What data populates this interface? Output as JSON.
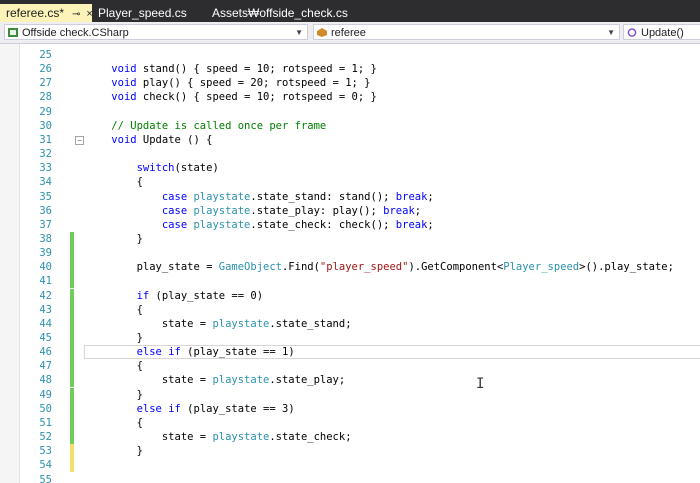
{
  "tabs": [
    {
      "label": "referee.cs*",
      "active": true,
      "pin": "⊸",
      "close": "×"
    },
    {
      "label": "Player_speed.cs",
      "active": false
    },
    {
      "label": "Assets₩offside_check.cs",
      "active": false
    }
  ],
  "nav": {
    "project": "Offside check.CSharp",
    "class": "referee",
    "member": "Update()"
  },
  "colors": {
    "keyword": "#0000ff",
    "type": "#2b91af",
    "comment": "#008000",
    "string": "#a31515",
    "changed_saved": "#6fcd5e",
    "changed_unsaved": "#efe16a"
  },
  "lines": [
    {
      "num": "25",
      "text": "",
      "marker": ""
    },
    {
      "num": "26",
      "text": "    void stand() { speed = 10; rotspeed = 1; }",
      "marker": ""
    },
    {
      "num": "27",
      "text": "    void play() { speed = 20; rotspeed = 1; }",
      "marker": ""
    },
    {
      "num": "28",
      "text": "    void check() { speed = 10; rotspeed = 0; }",
      "marker": ""
    },
    {
      "num": "29",
      "text": "",
      "marker": ""
    },
    {
      "num": "30",
      "text": "    // Update is called once per frame",
      "marker": ""
    },
    {
      "num": "31",
      "text": "    void Update () {",
      "marker": "",
      "fold": "−"
    },
    {
      "num": "32",
      "text": "",
      "marker": ""
    },
    {
      "num": "33",
      "text": "        switch(state)",
      "marker": ""
    },
    {
      "num": "34",
      "text": "        {",
      "marker": ""
    },
    {
      "num": "35",
      "text": "            case playstate.state_stand: stand(); break;",
      "marker": ""
    },
    {
      "num": "36",
      "text": "            case playstate.state_play: play(); break;",
      "marker": ""
    },
    {
      "num": "37",
      "text": "            case playstate.state_check: check(); break;",
      "marker": ""
    },
    {
      "num": "38",
      "text": "        }",
      "marker": "saved"
    },
    {
      "num": "39",
      "text": "",
      "marker": "saved"
    },
    {
      "num": "40",
      "text": "        play_state = GameObject.Find(\"player_speed\").GetComponent<Player_speed>().play_state;",
      "marker": "saved"
    },
    {
      "num": "41",
      "text": "",
      "marker": "saved"
    },
    {
      "num": "42",
      "text": "        if (play_state == 0)",
      "marker": "saved"
    },
    {
      "num": "43",
      "text": "        {",
      "marker": "saved"
    },
    {
      "num": "44",
      "text": "            state = playstate.state_stand;",
      "marker": "saved"
    },
    {
      "num": "45",
      "text": "        }",
      "marker": "saved"
    },
    {
      "num": "46",
      "text": "        else if (play_state == 1)",
      "marker": "saved",
      "current": true
    },
    {
      "num": "47",
      "text": "        {",
      "marker": "saved"
    },
    {
      "num": "48",
      "text": "            state = playstate.state_play;",
      "marker": "saved"
    },
    {
      "num": "49",
      "text": "        }",
      "marker": "saved"
    },
    {
      "num": "50",
      "text": "        else if (play_state == 3)",
      "marker": "saved"
    },
    {
      "num": "51",
      "text": "        {",
      "marker": "saved"
    },
    {
      "num": "52",
      "text": "            state = playstate.state_check;",
      "marker": "saved"
    },
    {
      "num": "53",
      "text": "        }",
      "marker": "unsaved"
    },
    {
      "num": "54",
      "text": "",
      "marker": "unsaved"
    },
    {
      "num": "55",
      "text": "",
      "marker": ""
    }
  ]
}
